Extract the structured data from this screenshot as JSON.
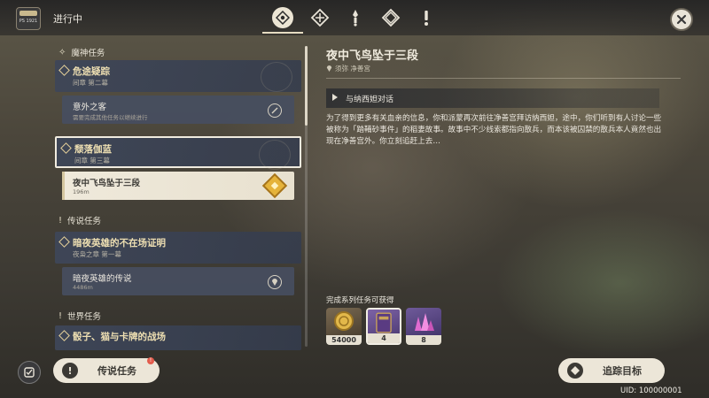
{
  "header": {
    "title": "进行中",
    "logo_text": "PS 1921",
    "tabs": [
      {
        "icon": "archon-quest-icon",
        "active": true
      },
      {
        "icon": "story-quest-icon",
        "active": false
      },
      {
        "icon": "legend-quest-icon",
        "active": false
      },
      {
        "icon": "world-quest-icon",
        "active": false
      },
      {
        "icon": "commission-quest-icon",
        "active": false
      }
    ]
  },
  "quest_list": {
    "archon_section": "魔神任务",
    "legend_section": "传说任务",
    "world_section": "世界任务",
    "q1": {
      "title": "危途疑踪",
      "subtitle": "间章 第二幕"
    },
    "q1_sub": {
      "title": "意外之客",
      "hint": "需要完成其他任务以继续进行"
    },
    "q2": {
      "title": "颓落伽蓝",
      "subtitle": "间章 第三幕"
    },
    "q2_sub": {
      "title": "夜中飞鸟坠于三段",
      "distance": "196m"
    },
    "q3": {
      "title": "暗夜英雄的不在场证明",
      "subtitle": "夜枭之章 第一幕"
    },
    "q3_sub": {
      "title": "暗夜英雄的传说",
      "distance": "4486m"
    },
    "q4": {
      "title": "骰子、猫与卡牌的战场"
    }
  },
  "detail": {
    "title": "夜中飞鸟坠于三段",
    "location": "须弥 净善宫",
    "step": "与纳西妲对话",
    "description": "为了得到更多有关血亲的信息，你和派蒙再次前往净善宫拜访纳西妲，途中，你们听到有人讨论一些被称为「踏鞴砂事件」的稻妻故事。故事中不少线索都指向散兵，而本该被囚禁的散兵本人竟然也出现在净善宫外。你立刻追赶上去…",
    "rewards_label": "完成系列任务可获得",
    "rewards": [
      {
        "item": "mora-coin",
        "count": "54000",
        "color": "#c99a3a"
      },
      {
        "item": "heros-wit-book",
        "count": "4",
        "color": "#6a4a8c"
      },
      {
        "item": "crystal-chunk",
        "count": "8",
        "color": "#8d5aa6"
      }
    ]
  },
  "footer": {
    "legend_button": "传说任务",
    "badge": "!",
    "track_button": "追踪目标",
    "uid": "UID: 100000001"
  }
}
